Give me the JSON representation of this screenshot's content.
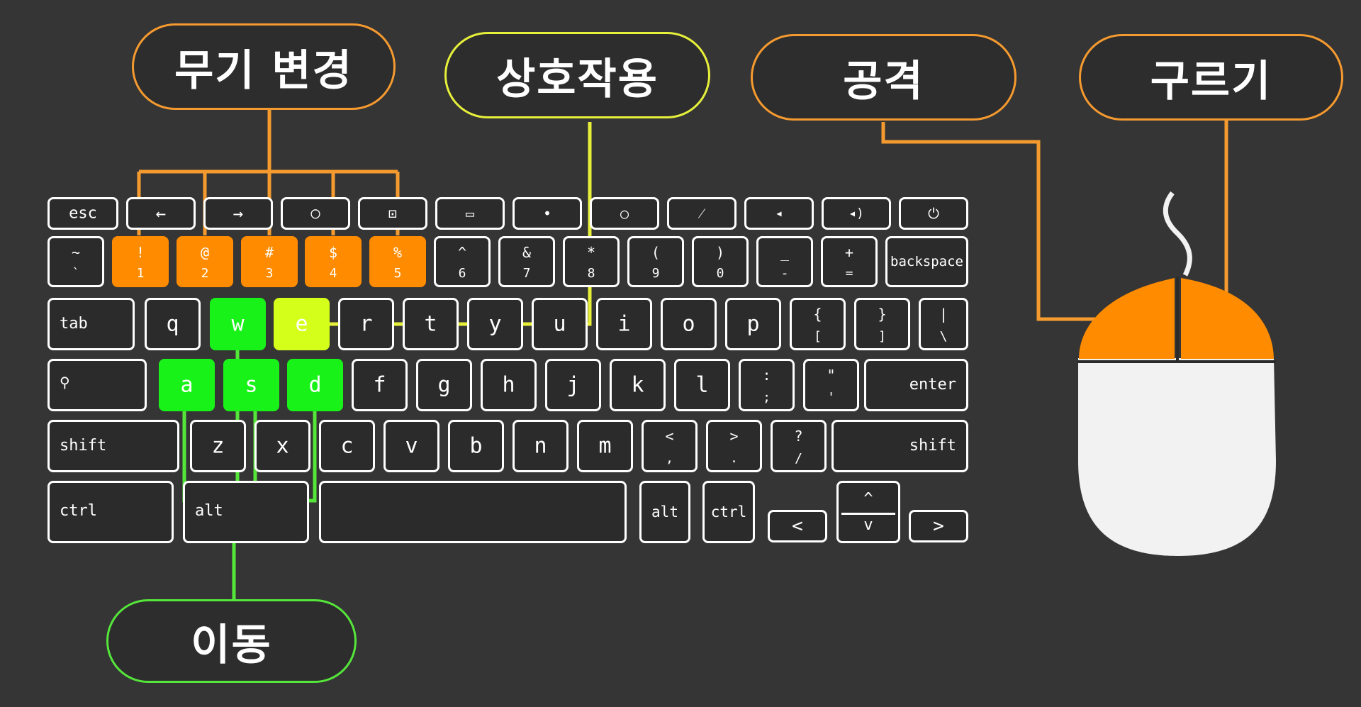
{
  "labels": {
    "weapon_change": "무기 변경",
    "interact": "상호작용",
    "attack": "공격",
    "roll": "구르기",
    "move": "이동"
  },
  "keyboard": {
    "fn_row": [
      "esc",
      "←",
      "→",
      "○",
      "⊡",
      "▭",
      "•",
      "○",
      "⁄",
      "◂",
      "◂)",
      "⏻"
    ],
    "number_row": [
      {
        "top": "~",
        "bot": "`"
      },
      {
        "top": "!",
        "bot": "1"
      },
      {
        "top": "@",
        "bot": "2"
      },
      {
        "top": "#",
        "bot": "3"
      },
      {
        "top": "$",
        "bot": "4"
      },
      {
        "top": "%",
        "bot": "5"
      },
      {
        "top": "^",
        "bot": "6"
      },
      {
        "top": "&",
        "bot": "7"
      },
      {
        "top": "*",
        "bot": "8"
      },
      {
        "top": "(",
        "bot": "9"
      },
      {
        "top": ")",
        "bot": "0"
      },
      {
        "top": "_",
        "bot": "-"
      },
      {
        "top": "+",
        "bot": "="
      }
    ],
    "backspace": "backspace",
    "tab": "tab",
    "qwerty_row": [
      "q",
      "w",
      "e",
      "r",
      "t",
      "y",
      "u",
      "i",
      "o",
      "p"
    ],
    "bracket_keys": [
      {
        "top": "{",
        "bot": "["
      },
      {
        "top": "}",
        "bot": "]"
      },
      {
        "top": "|",
        "bot": "\\"
      }
    ],
    "search": "⚲",
    "home_row": [
      "a",
      "s",
      "d",
      "f",
      "g",
      "h",
      "j",
      "k",
      "l"
    ],
    "semicolon_keys": [
      {
        "top": ":",
        "bot": ";"
      },
      {
        "top": "\"",
        "bot": "'"
      }
    ],
    "enter": "enter",
    "shift_left": "shift",
    "bottom_row": [
      "z",
      "x",
      "c",
      "v",
      "b",
      "n",
      "m"
    ],
    "punct_keys": [
      {
        "top": "<",
        "bot": ","
      },
      {
        "top": ">",
        "bot": "."
      },
      {
        "top": "?",
        "bot": "/"
      }
    ],
    "shift_right": "shift",
    "ctrl_left": "ctrl",
    "alt_left": "alt",
    "alt_right": "alt",
    "ctrl_right": "ctrl",
    "arrow_up": "^",
    "arrow_down": "v",
    "arrow_left": "<",
    "arrow_right": ">"
  },
  "colors": {
    "background": "#353535",
    "weapon": "#ff8c00",
    "move": "#19f219",
    "interact": "#d4ff1a",
    "attack_line": "#f59a2f",
    "mouse_body": "#f2f2f2"
  }
}
